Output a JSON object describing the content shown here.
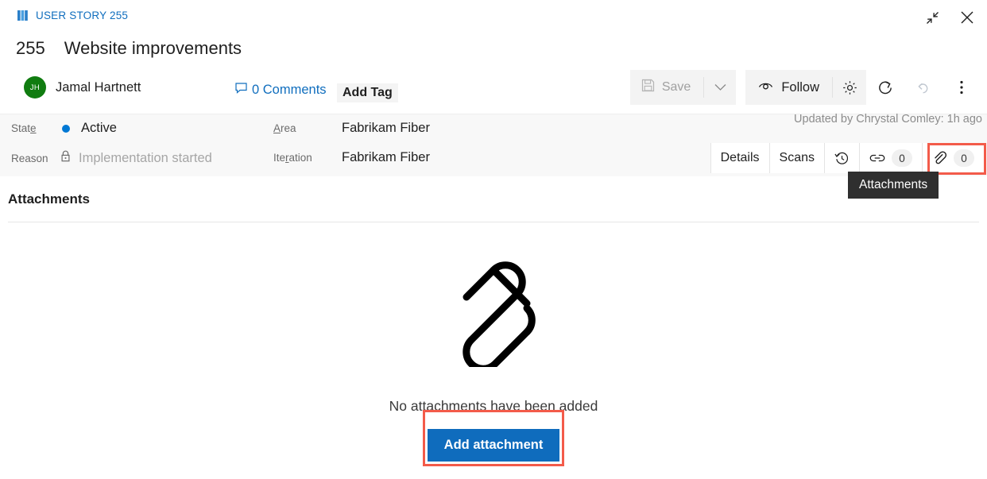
{
  "header": {
    "breadcrumb": "USER STORY 255",
    "breadcrumb_icon": "user-story-icon",
    "work_item_id": "255",
    "work_item_title": "Website improvements",
    "assignee_initials": "JH",
    "assignee_name": "Jamal Hartnett",
    "avatar_color": "#107c10",
    "comments_label": "0 Comments",
    "comments_icon": "comment-icon",
    "add_tag_label": "Add Tag",
    "accent_color": "#1a9bd7"
  },
  "window_controls": {
    "restore_icon": "restore-down-icon",
    "close_icon": "close-icon"
  },
  "toolbar": {
    "save_label": "Save",
    "save_icon": "floppy-disk-icon",
    "save_caret_icon": "chevron-down-icon",
    "save_disabled": true,
    "follow_label": "Follow",
    "follow_icon": "eye-icon",
    "gear_icon": "gear-icon",
    "refresh_icon": "refresh-icon",
    "undo_icon": "undo-icon",
    "more_icon": "more-vertical-icon"
  },
  "fields": {
    "state_label": "State",
    "state_label_pre": "Stat",
    "state_label_accel": "e",
    "state_value": "Active",
    "state_color": "#0078d4",
    "reason_label": "Reason",
    "reason_icon": "lock-icon",
    "reason_value": "Implementation started",
    "area_label_pre": "A",
    "area_label_accel": "A",
    "area_label_post": "rea",
    "area_value": "Fabrikam Fiber",
    "iteration_label_pre": "Ite",
    "iteration_label_accel": "r",
    "iteration_label_post": "ation",
    "iteration_value": "Fabrikam Fiber"
  },
  "status": {
    "updated_by": "Updated by Chrystal Comley: 1h ago"
  },
  "tabs": [
    {
      "label": "Details",
      "icon": "",
      "count": "",
      "selected": false
    },
    {
      "label": "Scans",
      "icon": "",
      "count": "",
      "selected": false
    },
    {
      "label": "",
      "icon": "history-icon",
      "count": "",
      "selected": false
    },
    {
      "label": "",
      "icon": "link-icon",
      "count": "0",
      "selected": false
    },
    {
      "label": "",
      "icon": "attachment-icon",
      "count": "0",
      "selected": true
    }
  ],
  "tooltip": {
    "text": "Attachments"
  },
  "section": {
    "title": "Attachments"
  },
  "empty_state": {
    "icon": "paperclip-icon",
    "message": "No attachments have been added",
    "button_label": "Add attachment",
    "button_color": "#0f6cbd"
  },
  "annotations": {
    "highlight_color": "#f35b4a"
  }
}
